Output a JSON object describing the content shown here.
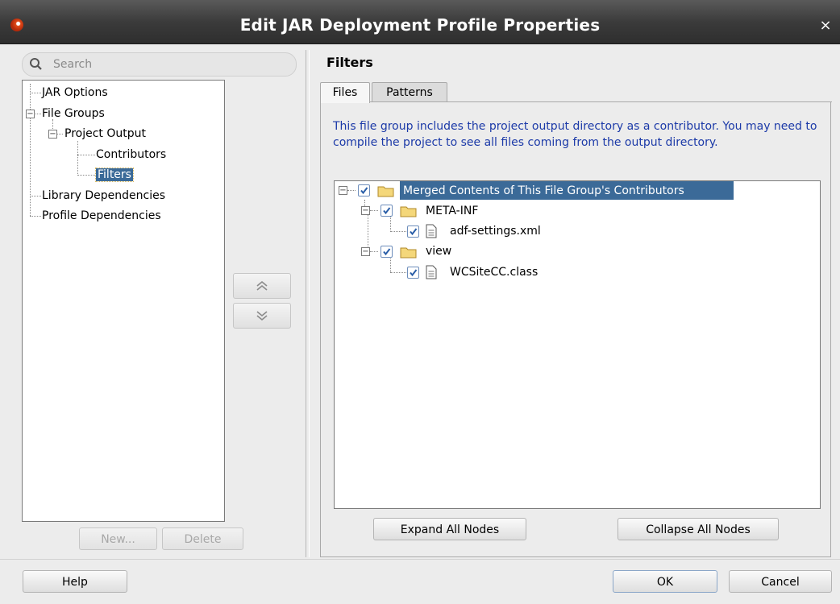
{
  "window": {
    "title": "Edit JAR Deployment Profile Properties",
    "close_glyph": "×"
  },
  "search": {
    "placeholder": "Search"
  },
  "nav_tree": {
    "items": [
      {
        "label": "JAR Options"
      },
      {
        "label": "File Groups"
      },
      {
        "label": "Project Output"
      },
      {
        "label": "Contributors"
      },
      {
        "label": "Filters",
        "selected": true
      },
      {
        "label": "Library Dependencies"
      },
      {
        "label": "Profile Dependencies"
      }
    ]
  },
  "left_buttons": {
    "new_label": "New...",
    "delete_label": "Delete"
  },
  "panel": {
    "title": "Filters",
    "tabs": [
      {
        "label": "Files",
        "active": true
      },
      {
        "label": "Patterns",
        "active": false
      }
    ],
    "info": "This file group includes the project output directory as a contributor.  You may need to compile the project to see all files coming from the output directory."
  },
  "files_tree": {
    "root": "Merged Contents of This File Group's Contributors",
    "folder1": "META-INF",
    "file1": "adf-settings.xml",
    "folder2": "view",
    "file2": "WCSiteCC.class"
  },
  "panel_buttons": {
    "expand_label": "Expand All Nodes",
    "collapse_label": "Collapse All Nodes"
  },
  "footer": {
    "help_label": "Help",
    "ok_label": "OK",
    "cancel_label": "Cancel"
  },
  "colors": {
    "selection": "#3b6a98",
    "info_text": "#1c3aa8",
    "title_bar": "#3b3b3b"
  }
}
